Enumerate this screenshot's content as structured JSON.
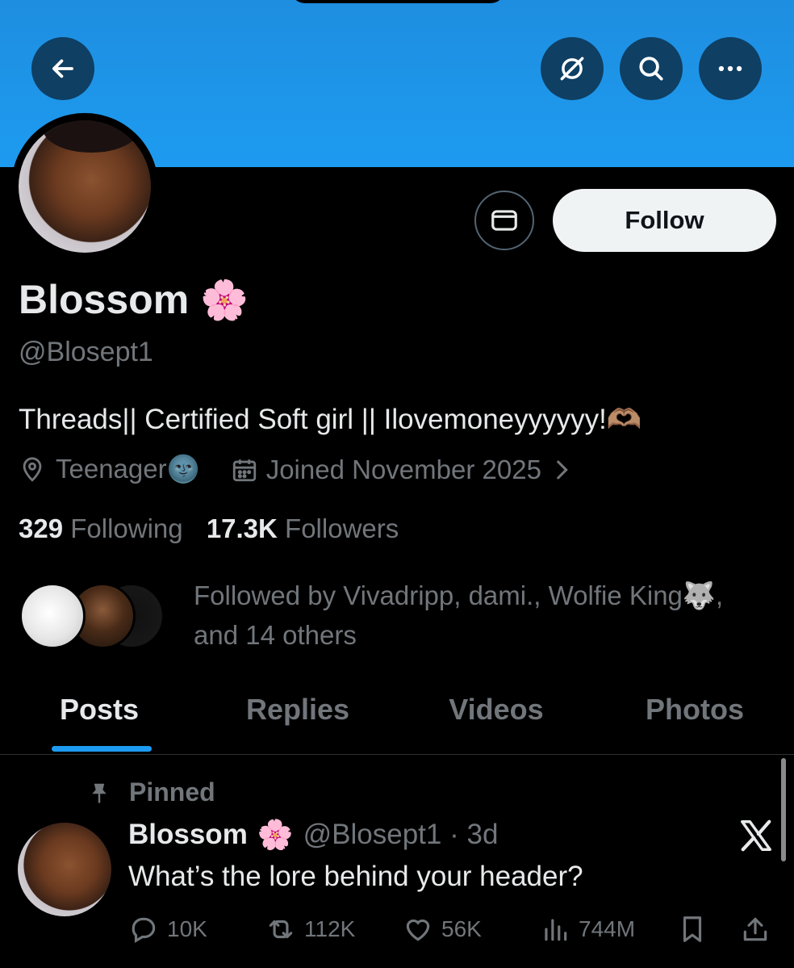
{
  "header": {
    "back_icon": "arrow-left-icon",
    "grok_icon": "grok-icon",
    "search_icon": "search-icon",
    "more_icon": "more-horizontal-icon",
    "banner_color": "#1d9bf0"
  },
  "profile": {
    "display_name": "Blossom",
    "name_emoji": "🌸",
    "handle": "@Blosept1",
    "bio": "Threads|| Certified Soft girl || Ilovemoneyyyyyy!🫶🏽",
    "location": "Teenager🌚",
    "joined": "Joined November 2025",
    "follow_label": "Follow",
    "following_count": "329",
    "following_label": "Following",
    "followers_count": "17.3K",
    "followers_label": "Followers",
    "followed_by_line1": "Followed by Vivadripp, dami., Wolfie King🐺,",
    "followed_by_line2": "and 14 others"
  },
  "tabs": [
    {
      "label": "Posts",
      "active": true
    },
    {
      "label": "Replies",
      "active": false
    },
    {
      "label": "Videos",
      "active": false
    },
    {
      "label": "Photos",
      "active": false
    }
  ],
  "post": {
    "pinned_label": "Pinned",
    "author": "Blossom",
    "author_emoji": "🌸",
    "handle_time": "@Blosept1 · 3d",
    "text": "What’s the lore behind your header?",
    "replies": "10K",
    "reposts": "112K",
    "likes": "56K",
    "views": "744M"
  }
}
